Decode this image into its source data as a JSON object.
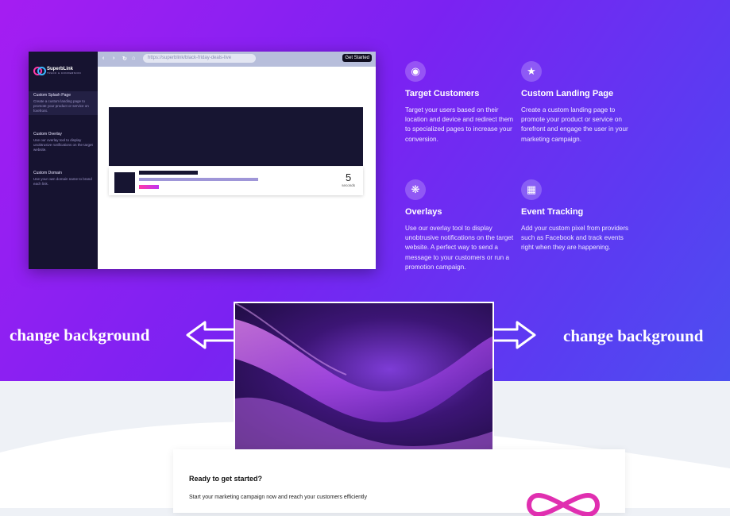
{
  "mock": {
    "brand": "SuperbLink",
    "brand_sub": "TRACK & CONVERSION",
    "url": "https://superblink/black-friday-deals-live",
    "get_started": "Get Started",
    "sidebar": [
      {
        "title": "Custom Splash Page",
        "desc": "Create a custom landing page to promote your product or service on forefront."
      },
      {
        "title": "Custom Overlay",
        "desc": "Use our overlay tool to display unobtrusive notifications on the target website."
      },
      {
        "title": "Custom Domain",
        "desc": "Use your own domain name to brand each link."
      }
    ],
    "countdown": "5",
    "countdown_unit": "seconds"
  },
  "features": [
    {
      "icon": "globe-icon",
      "title": "Target Customers",
      "desc": "Target your users based on their location and device and redirect them to specialized pages to increase your conversion."
    },
    {
      "icon": "star-icon",
      "title": "Custom Landing Page",
      "desc": "Create a custom landing page to promote your product or service on forefront and engage the user in your marketing campaign."
    },
    {
      "icon": "asterisk-icon",
      "title": "Overlays",
      "desc": "Use our overlay tool to display unobtrusive notifications on the target website. A perfect way to send a message to your customers or run a promotion campaign."
    },
    {
      "icon": "grid-icon",
      "title": "Event Tracking",
      "desc": "Add your custom pixel from providers such as Facebook and track events right when they are happening."
    }
  ],
  "annotations": {
    "left_label": "change background",
    "right_label": "change background"
  },
  "cta": {
    "title": "Ready to get started?",
    "text": "Start your marketing campaign now and reach your customers efficiently"
  },
  "colors": {
    "accent": "#e02fb0",
    "hero_start": "#a51df2",
    "hero_end": "#4c4ff0"
  }
}
